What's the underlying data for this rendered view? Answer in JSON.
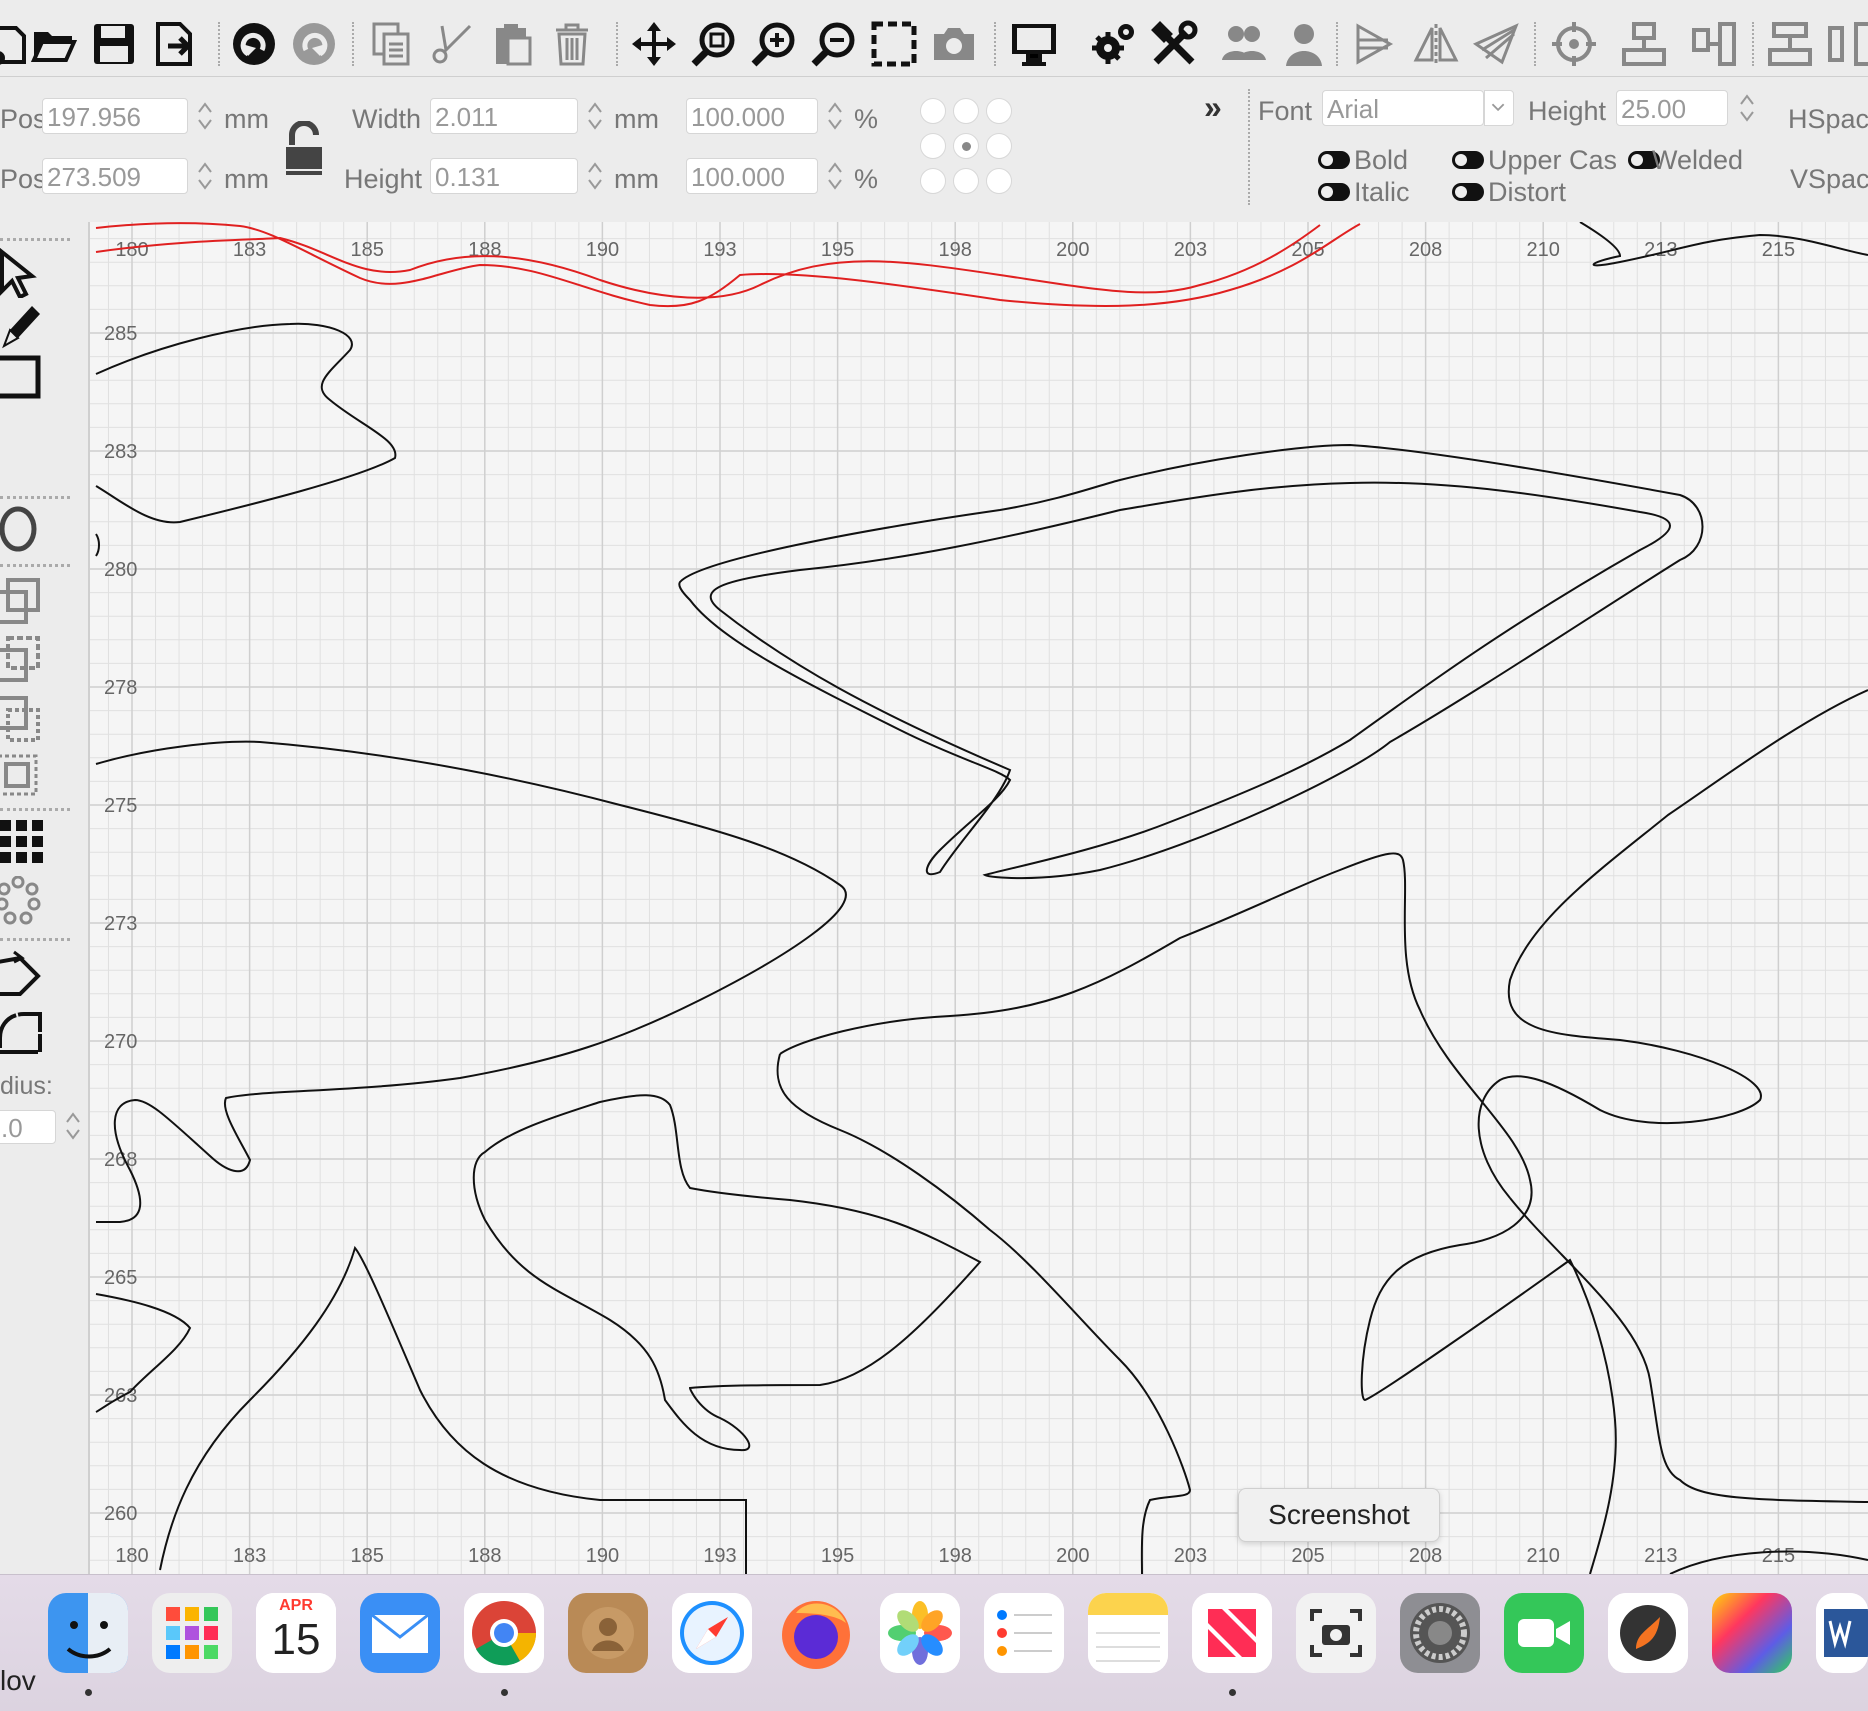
{
  "toolbar": {
    "icons": [
      "new-icon",
      "open-folder-icon",
      "save-icon",
      "export-icon",
      "undo-icon",
      "redo-icon",
      "copy-icon",
      "cut-icon",
      "paste-icon",
      "delete-icon",
      "move-icon",
      "zoom-fit-icon",
      "zoom-in-icon",
      "zoom-out-icon",
      "select-rect-icon",
      "camera-icon",
      "monitor-icon",
      "settings-gears-icon",
      "tools-icon",
      "group-icon",
      "user-icon",
      "align-icon",
      "mirror-icon",
      "send-icon",
      "target-icon",
      "distribute-v-icon",
      "distribute-h-icon",
      "align-vertical-icon",
      "align-horizontal-icon"
    ]
  },
  "props": {
    "xpos_label": "Pos",
    "xpos_value": "197.956",
    "ypos_label": "Pos",
    "ypos_value": "273.509",
    "unit_mm": "mm",
    "width_label": "Width",
    "width_value": "2.011",
    "height_label": "Height",
    "height_value": "0.131",
    "scale_w_value": "100.000",
    "scale_h_value": "100.000",
    "pct": "%",
    "expand": "»",
    "font_label": "Font",
    "font_value": "Arial",
    "font_height_label": "Height",
    "font_height_value": "25.00",
    "hspace_label": "HSpac",
    "vspace_label": "VSpac",
    "bold_label": "Bold",
    "italic_label": "Italic",
    "uppercase_label": "Upper Cas",
    "welded_label": "Welded",
    "distort_label": "Distort"
  },
  "leftbar": {
    "radius_label": "dius:",
    "radius_value": ".0"
  },
  "ruler": {
    "top_ticks": [
      "180",
      "183",
      "185",
      "188",
      "190",
      "193",
      "195",
      "198",
      "200",
      "203",
      "205",
      "208",
      "210",
      "213",
      "215"
    ],
    "left_ticks": [
      "285",
      "283",
      "280",
      "278",
      "275",
      "273",
      "270",
      "268",
      "265",
      "263",
      "260"
    ]
  },
  "tooltip": {
    "text": "Screenshot"
  },
  "dock": {
    "left_text": "lov",
    "calendar_month": "APR",
    "calendar_day": "15",
    "apps": [
      "finder-icon",
      "launchpad-icon",
      "calendar-icon",
      "mail-icon",
      "chrome-icon",
      "contacts-icon",
      "safari-icon",
      "firefox-icon",
      "photos-icon",
      "reminders-icon",
      "notes-icon",
      "news-icon",
      "screenshot-icon",
      "system-settings-icon",
      "facetime-icon",
      "lightburn-icon",
      "color-icon",
      "word-icon"
    ]
  },
  "colors": {
    "accent_red": "#e02020",
    "outline": "#111111",
    "grid": "#d4d4d4"
  }
}
